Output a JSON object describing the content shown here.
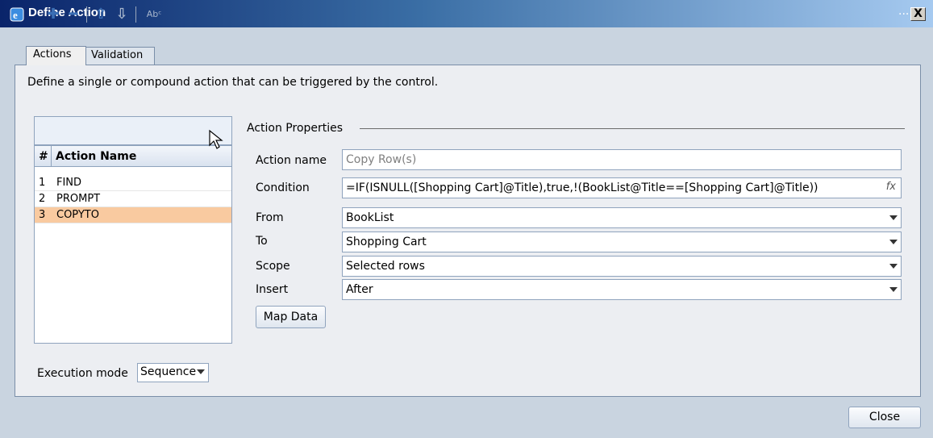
{
  "window": {
    "title": "Define Action",
    "dots": "...",
    "close_glyph": "X"
  },
  "tabs": [
    {
      "label": "Actions"
    },
    {
      "label": "Validation"
    }
  ],
  "description": "Define a single or compound action that can be triggered by the control.",
  "toolbar": {
    "rename_glyph": "Abᶜ"
  },
  "grid": {
    "headers": {
      "index": "#",
      "name": "Action Name"
    },
    "rows": [
      {
        "index": "1",
        "name": "FIND"
      },
      {
        "index": "2",
        "name": "PROMPT"
      },
      {
        "index": "3",
        "name": "COPYTO",
        "selected": true
      }
    ]
  },
  "execution": {
    "label": "Execution mode",
    "value": "Sequence"
  },
  "properties": {
    "title": "Action Properties",
    "action_name_label": "Action name",
    "action_name_placeholder": "Copy Row(s)",
    "condition_label": "Condition",
    "condition_value": "=IF(ISNULL([Shopping Cart]@Title),true,!(BookList@Title==[Shopping Cart]@Title))",
    "fx_glyph": "fx",
    "from_label": "From",
    "from_value": "BookList",
    "to_label": "To",
    "to_value": "Shopping Cart",
    "scope_label": "Scope",
    "scope_value": "Selected rows",
    "insert_label": "Insert",
    "insert_value": "After",
    "map_button": "Map Data"
  },
  "footer": {
    "close_button": "Close"
  },
  "colors": {
    "selected_row": "#f9caa0",
    "accent": "#3b6fb5"
  }
}
